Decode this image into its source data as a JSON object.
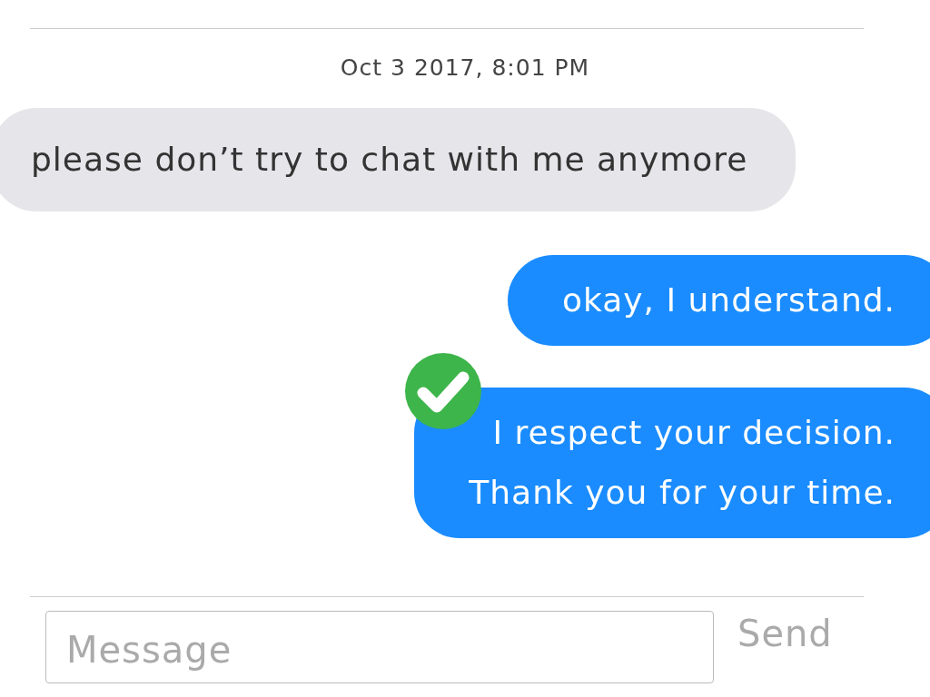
{
  "timestamp": "Oct 3 2017, 8:01 PM",
  "messages": [
    {
      "kind": "incoming",
      "text": "please don’t try to chat with me anymore",
      "checked": false
    },
    {
      "kind": "outgoing",
      "text": "okay, I understand.",
      "checked": false
    },
    {
      "kind": "outgoing",
      "text": "I respect your decision.\nThank you for your time.",
      "checked": true
    }
  ],
  "composer": {
    "placeholder": "Message",
    "send": {
      "label": "Send",
      "disabled": true
    }
  }
}
